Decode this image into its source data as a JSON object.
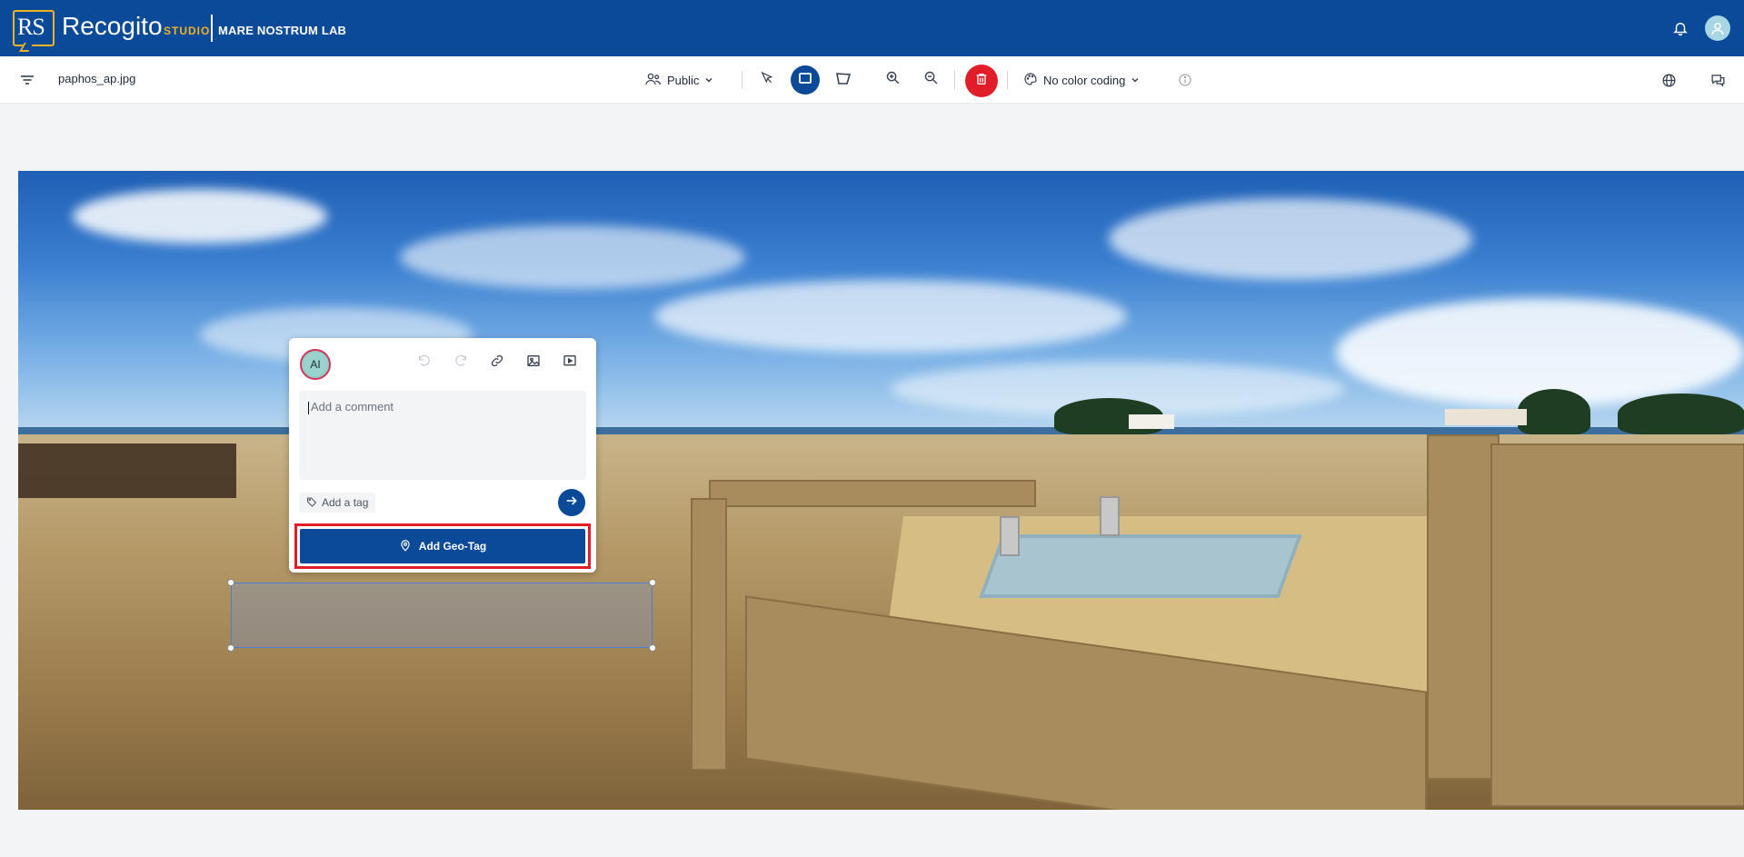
{
  "header": {
    "logo_text": "RS",
    "brand": "Recogito",
    "studio": "STUDIO",
    "lab": "MARE NOSTRUM LAB"
  },
  "toolbar": {
    "filename": "paphos_ap.jpg",
    "visibility": "Public",
    "color_coding": "No color coding",
    "active_tool": "rectangle"
  },
  "popup": {
    "avatar_initials": "AI",
    "comment_placeholder": "Add a comment",
    "tag_label": "Add a tag",
    "geo_button": "Add Geo-Tag"
  },
  "colors": {
    "header_bg": "#0b4a98",
    "accent": "#f0b323",
    "danger": "#e11d2a"
  }
}
